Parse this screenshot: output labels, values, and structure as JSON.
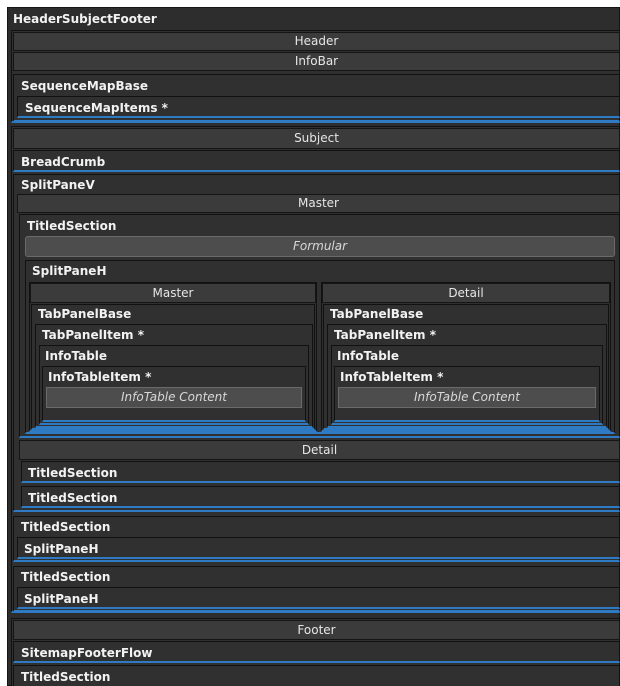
{
  "labels": {
    "hsf": "HeaderSubjectFooter",
    "header": "Header",
    "infobar": "InfoBar",
    "seqmapbase": "SequenceMapBase",
    "seqmapitems": "SequenceMapItems *",
    "subject": "Subject",
    "breadcrumb": "BreadCrumb",
    "splitpanev": "SplitPaneV",
    "master": "Master",
    "detail": "Detail",
    "titledsection": "TitledSection",
    "formular": "Formular",
    "splitpaneh": "SplitPaneH",
    "tabpanelbase": "TabPanelBase",
    "tabpanelitem": "TabPanelItem *",
    "infotable": "InfoTable",
    "infotableitem": "InfoTableItem *",
    "infotablecontent": "InfoTable Content",
    "footer": "Footer",
    "sitemapfooterflow": "SitemapFooterFlow"
  },
  "colors": {
    "background": "#2d2d2d",
    "bar": "#3b3b3b",
    "accent_blue": "#2e7bc4",
    "text": "#f2f2f2"
  }
}
